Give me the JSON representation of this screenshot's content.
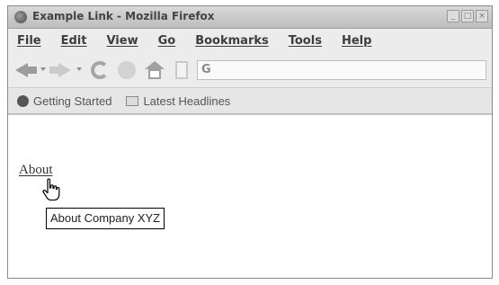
{
  "window": {
    "title": "Example Link - Mozilla Firefox",
    "controls": [
      "_",
      "□",
      "×"
    ]
  },
  "menubar": {
    "items": [
      "File",
      "Edit",
      "View",
      "Go",
      "Bookmarks",
      "Tools",
      "Help"
    ]
  },
  "navbar": {
    "icons": [
      "back-icon",
      "forward-icon",
      "reload-icon",
      "stop-icon",
      "home-icon",
      "bookmark-page-icon"
    ],
    "address_value": "",
    "favicon_glyph": "G"
  },
  "bookmarks": {
    "items": [
      {
        "label": "Getting Started",
        "icon": "firefox-icon"
      },
      {
        "label": "Latest Headlines",
        "icon": "feed-icon"
      }
    ]
  },
  "page": {
    "link_text": "About",
    "tooltip_text": "About Company XYZ"
  }
}
